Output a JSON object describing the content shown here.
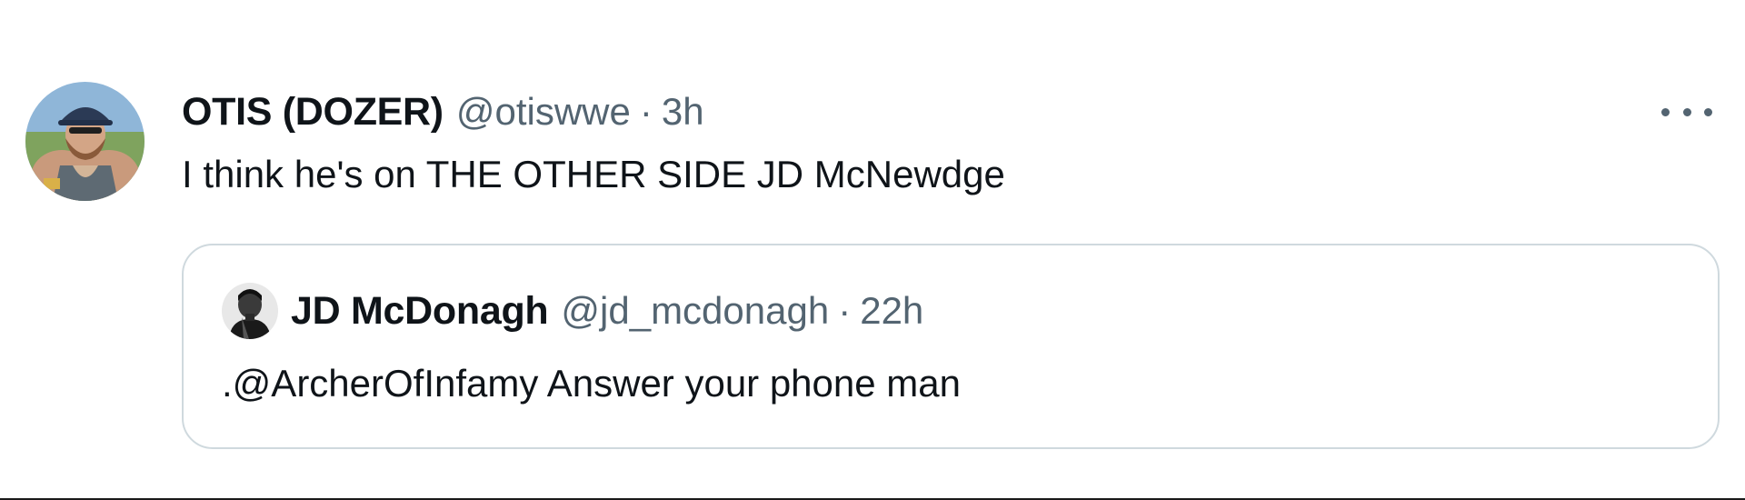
{
  "tweet": {
    "author": {
      "display_name": "OTIS (DOZER)",
      "handle": "@otiswwe",
      "avatar_icon": "user-avatar-photo"
    },
    "separator": "·",
    "time": "3h",
    "text": "I think he's on THE OTHER SIDE JD McNewdge",
    "more_icon": "more-options-icon"
  },
  "quote": {
    "author": {
      "display_name": "JD McDonagh",
      "handle": "@jd_mcdonagh",
      "avatar_icon": "user-avatar-photo"
    },
    "separator": "·",
    "time": "22h",
    "text": ".@ArcherOfInfamy Answer your phone man"
  },
  "colors": {
    "primary_text": "#0f1419",
    "secondary_text": "#536471",
    "card_border": "#cfd9de"
  }
}
